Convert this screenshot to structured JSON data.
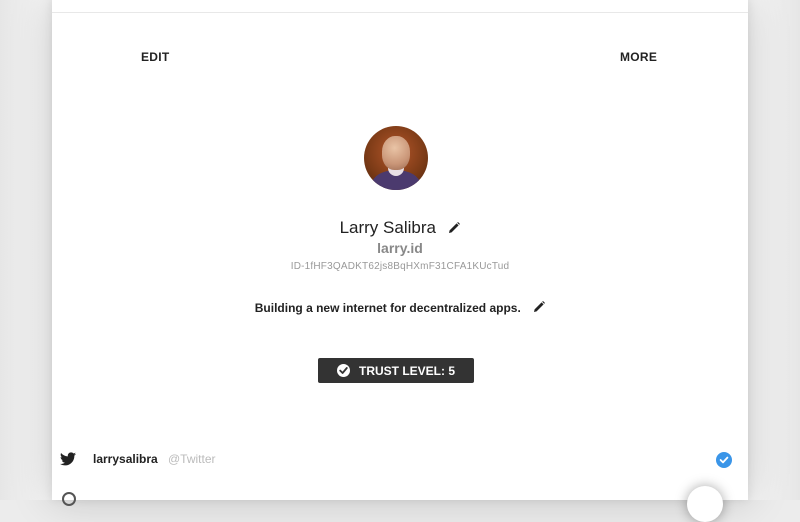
{
  "nav": {
    "edit_label": "EDIT",
    "more_label": "MORE"
  },
  "profile": {
    "name": "Larry Salibra",
    "domain": "larry.id",
    "id": "ID-1fHF3QADKT62js8BqHXmF31CFA1KUcTud",
    "bio": "Building a new internet for decentralized apps.",
    "trust_level": "TRUST LEVEL: 5"
  },
  "accounts": [
    {
      "icon": "twitter-icon",
      "handle": "larrysalibra",
      "service": "@Twitter",
      "verified": true
    }
  ],
  "colors": {
    "accent_verified": "#3a95e8",
    "badge_bg": "#333333"
  }
}
